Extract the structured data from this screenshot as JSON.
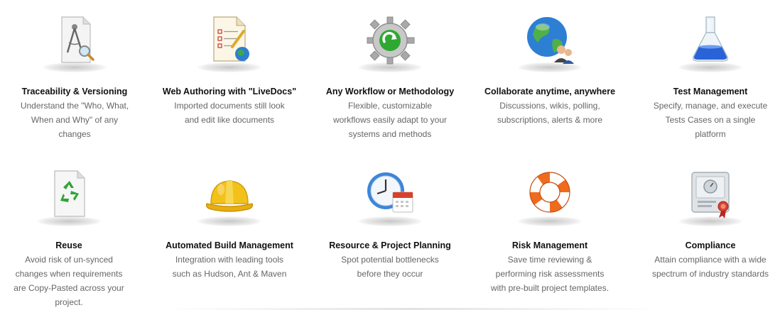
{
  "features": [
    {
      "title": "Traceability & Versioning",
      "desc": "Understand the \"Who, What, When and Why\" of any changes",
      "icon": "compass-document-icon"
    },
    {
      "title": "Web Authoring with \"LiveDocs\"",
      "desc": "Imported documents still look and edit like documents",
      "icon": "document-globe-icon"
    },
    {
      "title": "Any Workflow or Methodology",
      "desc": "Flexible, customizable workflows easily adapt to your systems and methods",
      "icon": "gear-refresh-icon"
    },
    {
      "title": "Collaborate anytime, anywhere",
      "desc": "Discussions, wikis, polling, subscriptions, alerts & more",
      "icon": "globe-users-icon"
    },
    {
      "title": "Test Management",
      "desc": "Specify, manage, and execute Tests Cases on a single platform",
      "icon": "flask-icon"
    },
    {
      "title": "Reuse",
      "desc": "Avoid risk of un-synced changes when requirements are Copy-Pasted across your project.",
      "icon": "recycle-document-icon"
    },
    {
      "title": "Automated Build Management",
      "desc": "Integration with leading tools such as Hudson, Ant & Maven",
      "icon": "hard-hat-icon"
    },
    {
      "title": "Resource & Project Planning",
      "desc": "Spot potential bottlenecks before they occur",
      "icon": "clock-calendar-icon"
    },
    {
      "title": "Risk Management",
      "desc": "Save time reviewing & performing risk assessments with pre-built project templates.",
      "icon": "lifebuoy-icon"
    },
    {
      "title": "Compliance",
      "desc": "Attain compliance with a wide spectrum of industry standards",
      "icon": "certificate-icon"
    }
  ]
}
